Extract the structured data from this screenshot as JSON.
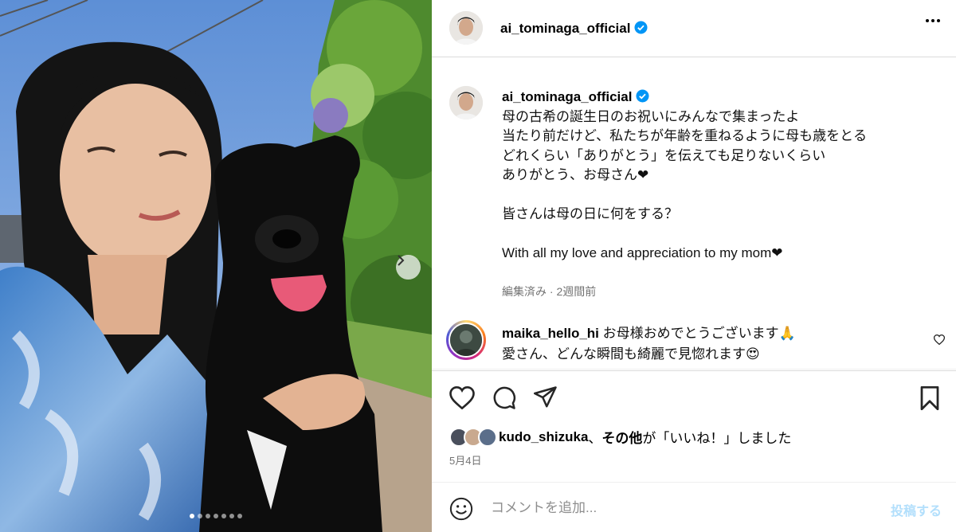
{
  "post": {
    "username": "ai_tominaga_official",
    "photo_alt": "",
    "carousel": {
      "total": 7,
      "active": 0
    }
  },
  "caption": {
    "username": "ai_tominaga_official",
    "lines": [
      "母の古希の誕生日のお祝いにみんなで集まったよ",
      "当たり前だけど、私たちが年齢を重ねるように母も歳をとる",
      "どれくらい「ありがとう」を伝えても足りないくらい",
      "ありがとう、お母さん❤",
      "",
      "皆さんは母の日に何をする？",
      "",
      "With all my love and appreciation to my mom❤"
    ],
    "meta": "編集済み · 2週間前"
  },
  "comment": {
    "username": "maika_hello_hi",
    "line1": "お母様おめでとうございます🙏",
    "line2": "愛さん、どんな瞬間も綺麗で見惚れます😍"
  },
  "likes": {
    "user": "kudo_shizuka",
    "sep": "、",
    "others": "その他",
    "suffix": "が「いいね！」しました"
  },
  "date": "5月4日",
  "comment_box": {
    "placeholder": "コメントを追加...",
    "post_label": "投稿する"
  },
  "colors": {
    "verified": "#0095f6",
    "muted": "#737373",
    "post_disabled": "#b2dffc",
    "border": "#dbdbdb"
  }
}
